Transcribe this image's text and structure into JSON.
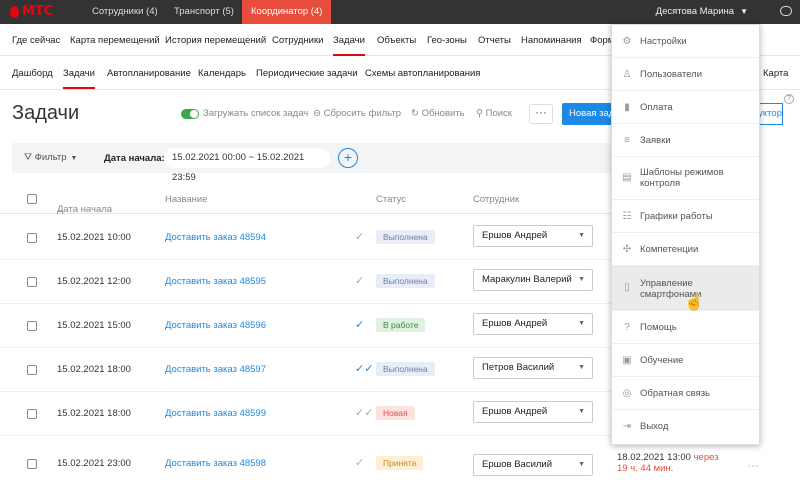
{
  "topbar": {
    "logo": "МТС",
    "tabs": [
      "Сотрудники (4)",
      "Транспорт (5)",
      "Координатор (4)"
    ],
    "user": "Десятова Марина"
  },
  "nav1": [
    "Где сейчас",
    "Карта перемещений",
    "История перемещений",
    "Сотрудники",
    "Задачи",
    "Объекты",
    "Гео-зоны",
    "Отчеты",
    "Напоминания",
    "Форм"
  ],
  "nav2": [
    "Дашборд",
    "Задачи",
    "Автопланирование",
    "Календарь",
    "Периодические задачи",
    "Схемы автопланирования"
  ],
  "nav2_right": "Карта",
  "page": {
    "title": "Задачи",
    "load_toggle": "Загружать список задач",
    "reset_filter": "Сбросить фильтр",
    "refresh": "Обновить",
    "search": "Поиск",
    "more": "···",
    "new_button": "Новая задача",
    "constructor_button": "Конструктор"
  },
  "filter": {
    "button": "Фильтр",
    "date_label": "Дата начала:",
    "date_value": "15.02.2021 00:00 ~ 15.02.2021 23:59"
  },
  "table": {
    "headers": [
      "Дата начала",
      "Название",
      "Статус",
      "Сотрудник"
    ],
    "rows": [
      {
        "date": "15.02.2021 10:00",
        "name": "Доставить заказ 48594",
        "status": "Выполнена",
        "employee": "Ершов Андрей"
      },
      {
        "date": "15.02.2021 12:00",
        "name": "Доставить заказ 48595",
        "status": "Выполнена",
        "employee": "Маракулин Валерий"
      },
      {
        "date": "15.02.2021 15:00",
        "name": "Доставить заказ 48596",
        "status": "В работе",
        "employee": "Ершов Андрей"
      },
      {
        "date": "15.02.2021 18:00",
        "name": "Доставить заказ 48597",
        "status": "Выполнена",
        "employee": "Петров Василий"
      },
      {
        "date": "15.02.2021 18:00",
        "name": "Доставить заказ 48599",
        "status": "Новая",
        "employee": "Ершов Андрей"
      },
      {
        "date": "15.02.2021 23:00",
        "name": "Доставить заказ 48598",
        "status": "Принята",
        "employee": "Ершов Василий"
      }
    ],
    "extra": {
      "date": "18.02.2021 13:00",
      "through": "через",
      "remain": "19 ч. 44 мин."
    }
  },
  "menu": {
    "items": [
      {
        "label": "Настройки",
        "icon": "gear-icon"
      },
      {
        "label": "Пользователи",
        "icon": "user-icon"
      },
      {
        "label": "Оплата",
        "icon": "card-icon"
      },
      {
        "label": "Заявки",
        "icon": "list-icon"
      },
      {
        "label": "Шаблоны режимов контроля",
        "icon": "calendar-icon"
      },
      {
        "label": "Графики работы",
        "icon": "schedule-icon"
      },
      {
        "label": "Компетенции",
        "icon": "puzzle-icon"
      },
      {
        "label": "Управление смартфонами",
        "icon": "phone-icon"
      },
      {
        "label": "Помощь",
        "icon": "help-icon"
      },
      {
        "label": "Обучение",
        "icon": "book-icon"
      },
      {
        "label": "Обратная связь",
        "icon": "globe-icon"
      },
      {
        "label": "Выход",
        "icon": "exit-icon"
      }
    ]
  },
  "colors": {
    "accent": "#e30611",
    "primary": "#1e88e5",
    "topbar": "#333333"
  }
}
